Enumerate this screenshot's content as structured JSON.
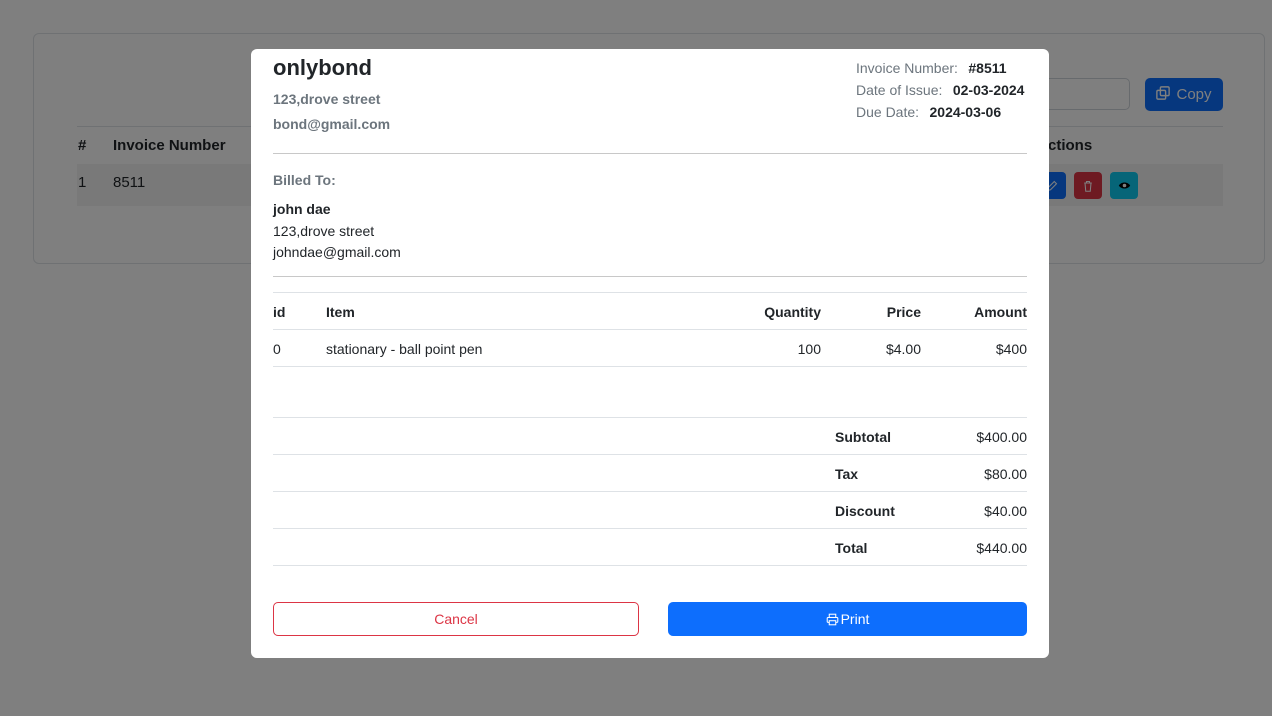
{
  "background": {
    "copy_button_label": "Copy",
    "table_headers": [
      "#",
      "Invoice Number",
      "ctions"
    ],
    "row": {
      "index": "1",
      "invoice_number": "8511"
    }
  },
  "invoice": {
    "company_name": "onlybond",
    "company_address": "123,drove street",
    "company_email": "bond@gmail.com",
    "invoice_number_label": "Invoice Number:",
    "invoice_number": "#8511",
    "date_of_issue_label": "Date of Issue:",
    "date_of_issue": "02-03-2024",
    "due_date_label": "Due Date:",
    "due_date": "2024-03-06",
    "billed_to_label": "Billed To:",
    "client_name": "john dae",
    "client_address": "123,drove street",
    "client_email": "johndae@gmail.com",
    "items_headers": {
      "id": "id",
      "item": "Item",
      "quantity": "Quantity",
      "price": "Price",
      "amount": "Amount"
    },
    "items": [
      {
        "id": "0",
        "item": "stationary - ball point pen",
        "quantity": "100",
        "price": "$4.00",
        "amount": "$400"
      }
    ],
    "totals": {
      "subtotal_label": "Subtotal",
      "subtotal": "$400.00",
      "tax_label": "Tax",
      "tax": "$80.00",
      "discount_label": "Discount",
      "discount": "$40.00",
      "total_label": "Total",
      "total": "$440.00"
    },
    "cancel_label": "Cancel",
    "print_label": "Print"
  },
  "colors": {
    "primary": "#0d6efd",
    "danger": "#dc3545",
    "info": "#0dcaf0",
    "muted": "#6c757d"
  },
  "icons": [
    "copy-icon",
    "edit-icon",
    "trash-icon",
    "eye-icon",
    "printer-icon"
  ]
}
